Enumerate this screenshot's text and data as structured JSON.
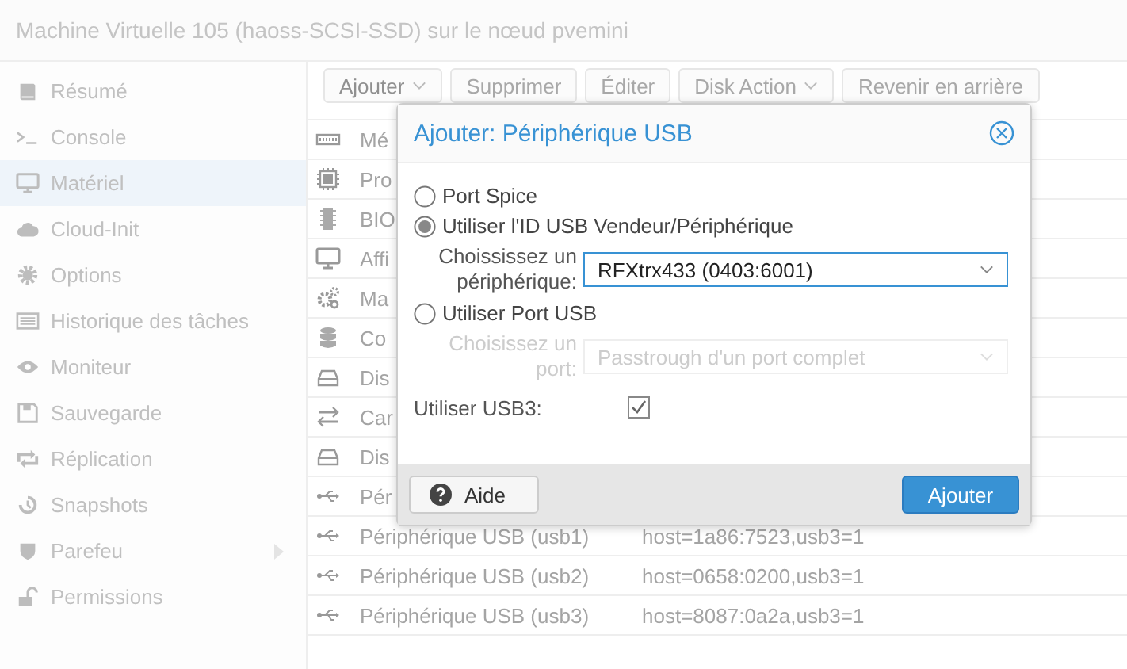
{
  "header": {
    "title": "Machine Virtuelle 105 (haoss-SCSI-SSD) sur le nœud pvemini"
  },
  "sidebar": {
    "items": [
      {
        "label": "Résumé",
        "selected": false,
        "expandable": false
      },
      {
        "label": "Console",
        "selected": false,
        "expandable": false
      },
      {
        "label": "Matériel",
        "selected": true,
        "expandable": false
      },
      {
        "label": "Cloud-Init",
        "selected": false,
        "expandable": false
      },
      {
        "label": "Options",
        "selected": false,
        "expandable": false
      },
      {
        "label": "Historique des tâches",
        "selected": false,
        "expandable": false
      },
      {
        "label": "Moniteur",
        "selected": false,
        "expandable": false
      },
      {
        "label": "Sauvegarde",
        "selected": false,
        "expandable": false
      },
      {
        "label": "Réplication",
        "selected": false,
        "expandable": false
      },
      {
        "label": "Snapshots",
        "selected": false,
        "expandable": false
      },
      {
        "label": "Parefeu",
        "selected": false,
        "expandable": true
      },
      {
        "label": "Permissions",
        "selected": false,
        "expandable": false
      }
    ]
  },
  "toolbar": {
    "buttons": [
      {
        "label": "Ajouter",
        "has_menu": true,
        "disabled": false
      },
      {
        "label": "Supprimer",
        "has_menu": false,
        "disabled": true
      },
      {
        "label": "Éditer",
        "has_menu": false,
        "disabled": true
      },
      {
        "label": "Disk Action",
        "has_menu": true,
        "disabled": true
      },
      {
        "label": "Revenir en arrière",
        "has_menu": false,
        "disabled": true
      }
    ]
  },
  "table": {
    "rows": [
      {
        "name": "Mé"
      },
      {
        "name": "Pro"
      },
      {
        "name": "BIO"
      },
      {
        "name": "Affi"
      },
      {
        "name": "Ma"
      },
      {
        "name": "Co"
      },
      {
        "name": "Dis"
      },
      {
        "name": "Car"
      },
      {
        "name": "Dis"
      },
      {
        "name": "Pér"
      },
      {
        "name": "Périphérique USB (usb1)",
        "value": "host=1a86:7523,usb3=1"
      },
      {
        "name": "Périphérique USB (usb2)",
        "value": "host=0658:0200,usb3=1"
      },
      {
        "name": "Périphérique USB (usb3)",
        "value": "host=8087:0a2a,usb3=1"
      }
    ]
  },
  "dialog": {
    "title": "Ajouter: Périphérique USB",
    "items": [
      {
        "kind": "radio",
        "label": "Port Spice",
        "selected": false
      },
      {
        "kind": "radio",
        "label": "Utiliser l'ID USB Vendeur/Périphérique",
        "selected": true
      },
      {
        "kind": "combo",
        "label": "Choississez un périphérique:",
        "value": "RFXtrx433 (0403:6001)",
        "disabled": false,
        "focused": true
      },
      {
        "kind": "radio",
        "label": "Utiliser Port USB",
        "selected": false
      },
      {
        "kind": "combo",
        "label": "Choisissez un port:",
        "placeholder": "Passtrough d'un port complet",
        "disabled": true,
        "focused": false
      },
      {
        "kind": "checkbox",
        "label": "Utiliser USB3:",
        "checked": true
      }
    ],
    "help_button": "Aide",
    "submit_button": "Ajouter"
  }
}
